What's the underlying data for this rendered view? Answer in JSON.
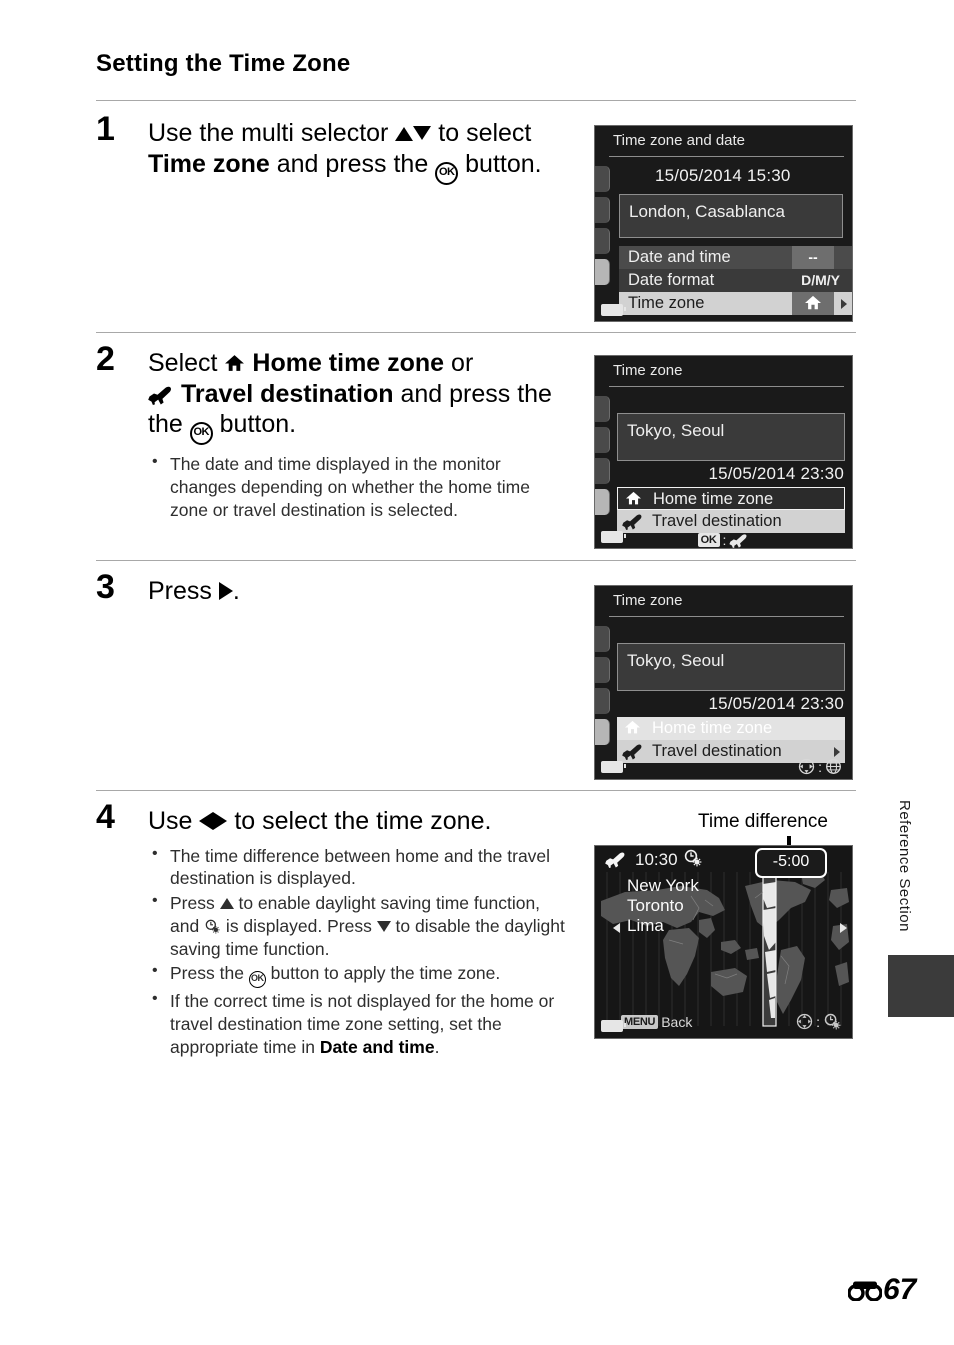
{
  "page": {
    "title": "Setting the Time Zone",
    "side_label": "Reference Section",
    "folio_icon": "e-reference-icon",
    "folio_number": "67"
  },
  "steps": [
    {
      "number": "1",
      "lead_parts": [
        "Use the multi selector ",
        "up-triangle",
        "down-triangle",
        " to select ",
        "Time zone",
        " and press the ",
        "ok-button",
        " button."
      ],
      "lead_plain": "Use the multi selector ▲▼ to select Time zone and press the ⒪ button.",
      "bullets": []
    },
    {
      "number": "2",
      "lead_plain": "Select ⌂ Home time zone or ✈ Travel destination and press the ⒪ button.",
      "bullets": [
        "The date and time displayed in the monitor changes depending on whether the home time zone or travel destination is selected."
      ]
    },
    {
      "number": "3",
      "lead_plain": "Press ▶.",
      "bullets": []
    },
    {
      "number": "4",
      "lead_plain": "Use ◀▶ to select the time zone.",
      "bullets": [
        "The time difference between home and the travel destination is displayed.",
        "Press ▲ to enable daylight saving time function, and ☀ is displayed. Press ▼ to disable the daylight saving time function.",
        "Press the ⒪ button to apply the time zone.",
        "If the correct time is not displayed for the home or travel destination time zone setting, set the appropriate time in Date and time."
      ]
    }
  ],
  "step1_text": {
    "a": "Use the multi selector ",
    "b": " to select ",
    "bold1": "Time zone",
    "c": " and press the ",
    "d": " button."
  },
  "step2_text": {
    "a": "Select ",
    "bold1": "Home time zone",
    "b": " or ",
    "bold2": "Travel destination",
    "c": " and press the ",
    "d": " button.",
    "bullet1": "The date and time displayed in the monitor changes depending on whether the home time zone or travel destination is selected."
  },
  "step3_text": {
    "a": "Press ",
    "b": "."
  },
  "step4_text": {
    "a": "Use ",
    "b": " to select the time zone.",
    "bullet1": "The time difference between home and the travel destination is displayed.",
    "bullet2a": "Press ",
    "bullet2b": " to enable daylight saving time function, and ",
    "bullet2c": " is displayed. Press ",
    "bullet2d": " to disable the daylight saving time function.",
    "bullet3a": "Press the ",
    "bullet3b": " button to apply the time zone.",
    "bullet4a": "If the correct time is not displayed for the home or travel destination time zone setting, set the appropriate time in ",
    "bullet4bold": "Date and time",
    "bullet4c": "."
  },
  "screen1": {
    "title": "Time zone and date",
    "datetime": "15/05/2014  15:30",
    "zone_name": "London, Casablanca",
    "rows": [
      {
        "label": "Date and time",
        "value": "--",
        "state": "dark"
      },
      {
        "label": "Date format",
        "value": "D/M/Y",
        "state": "darker"
      },
      {
        "label": "Time zone",
        "value": "home-icon",
        "state": "light"
      }
    ]
  },
  "screen2": {
    "title": "Time zone",
    "zone_name": "Tokyo, Seoul",
    "datetime": "15/05/2014  23:30",
    "rows": [
      {
        "icon": "home-icon",
        "label": "Home time zone",
        "state": "outline"
      },
      {
        "icon": "plane-icon",
        "label": "Travel destination",
        "state": "light"
      }
    ],
    "hint_ok": "OK",
    "hint_sep": ":",
    "hint_icon": "plane-icon"
  },
  "screen3": {
    "title": "Time zone",
    "zone_name": "Tokyo, Seoul",
    "datetime": "15/05/2014  23:30",
    "rows": [
      {
        "icon": "home-icon",
        "label": "Home time zone",
        "state": "light-top"
      },
      {
        "icon": "plane-icon",
        "label": "Travel destination",
        "state": "light"
      }
    ],
    "hint_icon_left": "multi-selector-icon",
    "hint_sep": ":",
    "hint_icon_right": "globe-icon"
  },
  "screen4": {
    "callout_label": "Time difference",
    "plane_icon": "plane-icon",
    "time": "10:30",
    "dst_icon": "daylight-saving-icon",
    "time_difference": "-5:00",
    "cities": [
      "New York",
      "Toronto",
      "Lima"
    ],
    "menu_chip": "MENU",
    "back_label": "Back",
    "hint_icon_left": "multi-selector-icon",
    "hint_sep": ":",
    "hint_icon_right": "daylight-saving-icon"
  },
  "colors": {
    "screen_bg": "#1a1a1a",
    "row_dark": "#4b4b4b",
    "row_light": "#d2d2d2",
    "text_light": "#efefef",
    "rule": "#a8a8a8"
  }
}
